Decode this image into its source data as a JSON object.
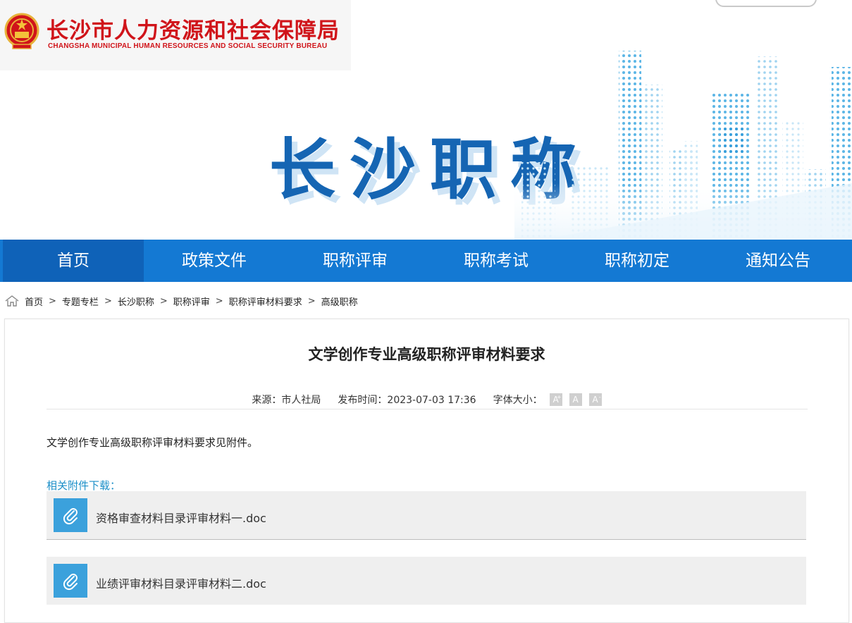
{
  "header": {
    "bureau_name_cn": "长沙市人力资源和社会保障局",
    "bureau_name_en": "CHANGSHA MUNICIPAL HUMAN RESOURCES AND SOCIAL SECURITY BUREAU",
    "banner_title": "长沙职称"
  },
  "nav": {
    "items": [
      {
        "label": "首页"
      },
      {
        "label": "政策文件"
      },
      {
        "label": "职称评审"
      },
      {
        "label": "职称考试"
      },
      {
        "label": "职称初定"
      },
      {
        "label": "通知公告"
      }
    ],
    "active_index": 0,
    "colors": {
      "bar": "#1479d3",
      "active": "#0f62b8"
    }
  },
  "breadcrumb": {
    "items": [
      "首页",
      "专题专栏",
      "长沙职称",
      "职称评审",
      "职称评审材料要求",
      "高级职称"
    ],
    "separator": ">"
  },
  "article": {
    "title": "文学创作专业高级职称评审材料要求",
    "source_label": "来源：市人社局",
    "publish_label": "发布时间：2023-07-03 17:36",
    "font_size_label": "字体大小：",
    "font_buttons": [
      "A",
      "A",
      "A"
    ],
    "body": "文学创作专业高级职称评审材料要求见附件。",
    "attachments_label": "相关附件下载：",
    "attachments": [
      {
        "name": "资格审查材料目录评审材料一.doc",
        "icon": "paperclip-icon"
      },
      {
        "name": "业绩评审材料目录评审材料二.doc",
        "icon": "paperclip-icon"
      }
    ]
  },
  "colors": {
    "brand_red": "#d0141a",
    "title_blue": "#1565b3",
    "attachment_label": "#1c8fc8",
    "attachment_icon_bg": "#3ba1dc"
  }
}
